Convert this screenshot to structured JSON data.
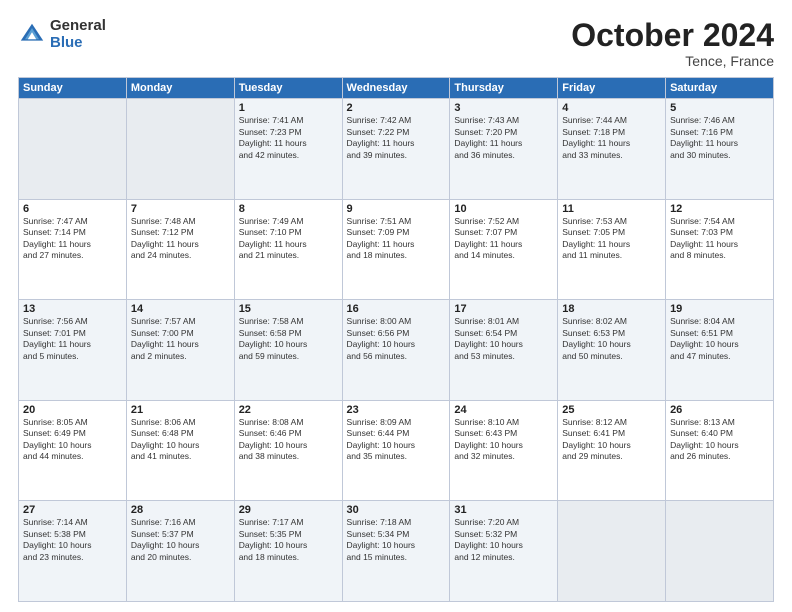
{
  "logo": {
    "general": "General",
    "blue": "Blue"
  },
  "title": "October 2024",
  "subtitle": "Tence, France",
  "weekdays": [
    "Sunday",
    "Monday",
    "Tuesday",
    "Wednesday",
    "Thursday",
    "Friday",
    "Saturday"
  ],
  "weeks": [
    [
      {
        "day": "",
        "info": ""
      },
      {
        "day": "",
        "info": ""
      },
      {
        "day": "1",
        "info": "Sunrise: 7:41 AM\nSunset: 7:23 PM\nDaylight: 11 hours\nand 42 minutes."
      },
      {
        "day": "2",
        "info": "Sunrise: 7:42 AM\nSunset: 7:22 PM\nDaylight: 11 hours\nand 39 minutes."
      },
      {
        "day": "3",
        "info": "Sunrise: 7:43 AM\nSunset: 7:20 PM\nDaylight: 11 hours\nand 36 minutes."
      },
      {
        "day": "4",
        "info": "Sunrise: 7:44 AM\nSunset: 7:18 PM\nDaylight: 11 hours\nand 33 minutes."
      },
      {
        "day": "5",
        "info": "Sunrise: 7:46 AM\nSunset: 7:16 PM\nDaylight: 11 hours\nand 30 minutes."
      }
    ],
    [
      {
        "day": "6",
        "info": "Sunrise: 7:47 AM\nSunset: 7:14 PM\nDaylight: 11 hours\nand 27 minutes."
      },
      {
        "day": "7",
        "info": "Sunrise: 7:48 AM\nSunset: 7:12 PM\nDaylight: 11 hours\nand 24 minutes."
      },
      {
        "day": "8",
        "info": "Sunrise: 7:49 AM\nSunset: 7:10 PM\nDaylight: 11 hours\nand 21 minutes."
      },
      {
        "day": "9",
        "info": "Sunrise: 7:51 AM\nSunset: 7:09 PM\nDaylight: 11 hours\nand 18 minutes."
      },
      {
        "day": "10",
        "info": "Sunrise: 7:52 AM\nSunset: 7:07 PM\nDaylight: 11 hours\nand 14 minutes."
      },
      {
        "day": "11",
        "info": "Sunrise: 7:53 AM\nSunset: 7:05 PM\nDaylight: 11 hours\nand 11 minutes."
      },
      {
        "day": "12",
        "info": "Sunrise: 7:54 AM\nSunset: 7:03 PM\nDaylight: 11 hours\nand 8 minutes."
      }
    ],
    [
      {
        "day": "13",
        "info": "Sunrise: 7:56 AM\nSunset: 7:01 PM\nDaylight: 11 hours\nand 5 minutes."
      },
      {
        "day": "14",
        "info": "Sunrise: 7:57 AM\nSunset: 7:00 PM\nDaylight: 11 hours\nand 2 minutes."
      },
      {
        "day": "15",
        "info": "Sunrise: 7:58 AM\nSunset: 6:58 PM\nDaylight: 10 hours\nand 59 minutes."
      },
      {
        "day": "16",
        "info": "Sunrise: 8:00 AM\nSunset: 6:56 PM\nDaylight: 10 hours\nand 56 minutes."
      },
      {
        "day": "17",
        "info": "Sunrise: 8:01 AM\nSunset: 6:54 PM\nDaylight: 10 hours\nand 53 minutes."
      },
      {
        "day": "18",
        "info": "Sunrise: 8:02 AM\nSunset: 6:53 PM\nDaylight: 10 hours\nand 50 minutes."
      },
      {
        "day": "19",
        "info": "Sunrise: 8:04 AM\nSunset: 6:51 PM\nDaylight: 10 hours\nand 47 minutes."
      }
    ],
    [
      {
        "day": "20",
        "info": "Sunrise: 8:05 AM\nSunset: 6:49 PM\nDaylight: 10 hours\nand 44 minutes."
      },
      {
        "day": "21",
        "info": "Sunrise: 8:06 AM\nSunset: 6:48 PM\nDaylight: 10 hours\nand 41 minutes."
      },
      {
        "day": "22",
        "info": "Sunrise: 8:08 AM\nSunset: 6:46 PM\nDaylight: 10 hours\nand 38 minutes."
      },
      {
        "day": "23",
        "info": "Sunrise: 8:09 AM\nSunset: 6:44 PM\nDaylight: 10 hours\nand 35 minutes."
      },
      {
        "day": "24",
        "info": "Sunrise: 8:10 AM\nSunset: 6:43 PM\nDaylight: 10 hours\nand 32 minutes."
      },
      {
        "day": "25",
        "info": "Sunrise: 8:12 AM\nSunset: 6:41 PM\nDaylight: 10 hours\nand 29 minutes."
      },
      {
        "day": "26",
        "info": "Sunrise: 8:13 AM\nSunset: 6:40 PM\nDaylight: 10 hours\nand 26 minutes."
      }
    ],
    [
      {
        "day": "27",
        "info": "Sunrise: 7:14 AM\nSunset: 5:38 PM\nDaylight: 10 hours\nand 23 minutes."
      },
      {
        "day": "28",
        "info": "Sunrise: 7:16 AM\nSunset: 5:37 PM\nDaylight: 10 hours\nand 20 minutes."
      },
      {
        "day": "29",
        "info": "Sunrise: 7:17 AM\nSunset: 5:35 PM\nDaylight: 10 hours\nand 18 minutes."
      },
      {
        "day": "30",
        "info": "Sunrise: 7:18 AM\nSunset: 5:34 PM\nDaylight: 10 hours\nand 15 minutes."
      },
      {
        "day": "31",
        "info": "Sunrise: 7:20 AM\nSunset: 5:32 PM\nDaylight: 10 hours\nand 12 minutes."
      },
      {
        "day": "",
        "info": ""
      },
      {
        "day": "",
        "info": ""
      }
    ]
  ]
}
